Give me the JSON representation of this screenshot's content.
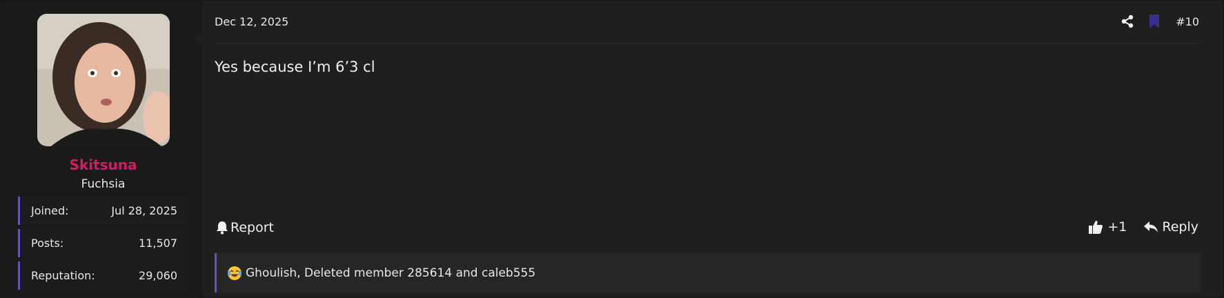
{
  "user": {
    "name": "Skitsuna",
    "title": "Fuchsia",
    "stats": {
      "joined_label": "Joined:",
      "joined_value": "Jul 28, 2025",
      "posts_label": "Posts:",
      "posts_value": "11,507",
      "reputation_label": "Reputation:",
      "reputation_value": "29,060"
    },
    "name_color": "#d11d63"
  },
  "post": {
    "date": "Dec 12, 2025",
    "number": "#10",
    "message": "Yes because I’m 6’3 cl",
    "report_label": "Report",
    "like_count": "+1",
    "reply_label": "Reply",
    "reactions_text": "Ghoulish, Deleted member 285614 and caleb555",
    "icons": [
      "share-icon",
      "bookmark-icon",
      "bell-icon",
      "thumbs-up-icon",
      "reply-arrow-icon",
      "crying-laughing-emoji-icon"
    ]
  },
  "colors": {
    "accent": "#6a4fc7",
    "bookmark": "#3a2f8f",
    "background": "#1f1f1f"
  }
}
